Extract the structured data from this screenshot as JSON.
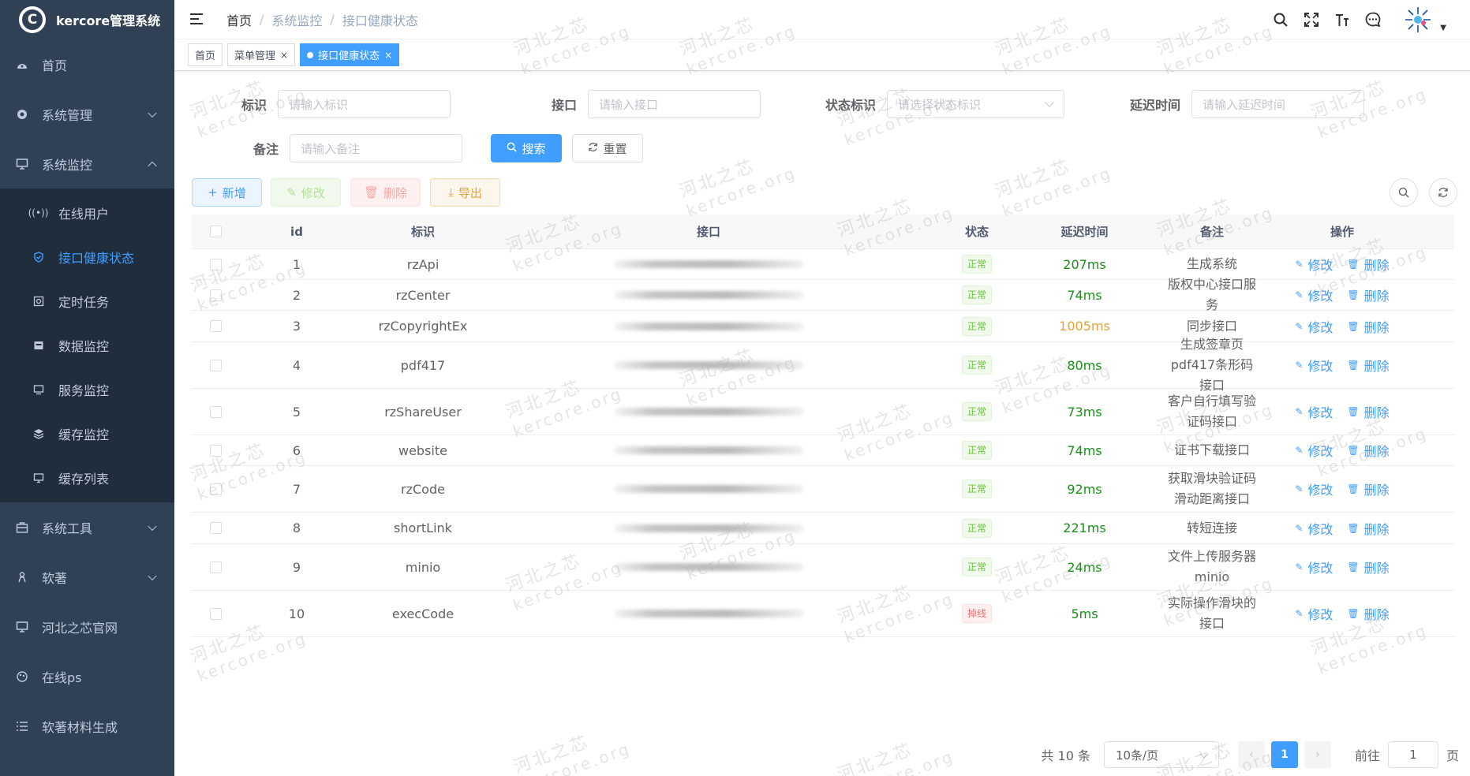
{
  "app": {
    "title": "kercore管理系统",
    "logo_letter": "C"
  },
  "sidebar": {
    "items": [
      {
        "label": "首页",
        "icon": "dashboard-icon"
      },
      {
        "label": "系统管理",
        "icon": "gear-icon"
      },
      {
        "label": "系统监控",
        "icon": "monitor-icon"
      },
      {
        "label": "系统工具",
        "icon": "toolbox-icon"
      },
      {
        "label": "软著",
        "icon": "user-icon"
      },
      {
        "label": "河北之芯官网",
        "icon": "monitor-icon"
      },
      {
        "label": "在线ps",
        "icon": "palette-icon"
      },
      {
        "label": "软著材料生成",
        "icon": "list-icon"
      }
    ],
    "sub_items": [
      {
        "label": "在线用户",
        "icon": "online-icon"
      },
      {
        "label": "接口健康状态",
        "icon": "shield-icon"
      },
      {
        "label": "定时任务",
        "icon": "job-icon"
      },
      {
        "label": "数据监控",
        "icon": "database-icon"
      },
      {
        "label": "服务监控",
        "icon": "server-icon"
      },
      {
        "label": "缓存监控",
        "icon": "redis-icon"
      },
      {
        "label": "缓存列表",
        "icon": "list-icon"
      }
    ]
  },
  "breadcrumb": {
    "home": "首页",
    "section": "系统监控",
    "current": "接口健康状态",
    "sep": "/"
  },
  "tabs": [
    {
      "label": "首页"
    },
    {
      "label": "菜单管理",
      "close": "×"
    },
    {
      "label": "接口健康状态",
      "close": "×"
    }
  ],
  "form": {
    "label_id": "标识",
    "ph_id": "请输入标识",
    "label_api": "接口",
    "ph_api": "请输入接口",
    "label_status": "状态标识",
    "ph_status": "请选择状态标识",
    "label_delay": "延迟时间",
    "ph_delay": "请输入延迟时间",
    "label_remark": "备注",
    "ph_remark": "请输入备注",
    "search": "搜索",
    "reset": "重置"
  },
  "toolbar": {
    "add": "新增",
    "edit": "修改",
    "delete": "删除",
    "export": "导出"
  },
  "table": {
    "headers": [
      "id",
      "标识",
      "接口",
      "状态",
      "延迟时间",
      "备注",
      "操作"
    ],
    "edit_label": "修改",
    "delete_label": "删除",
    "rows": [
      {
        "id": "1",
        "name": "rzApi",
        "status": "正常",
        "status_type": "ok",
        "delay": "207ms",
        "delay_type": "ok",
        "remark": "生成系统",
        "h": 39
      },
      {
        "id": "2",
        "name": "rzCenter",
        "status": "正常",
        "status_type": "ok",
        "delay": "74ms",
        "delay_type": "ok",
        "remark": "版权中心接口服务",
        "h": 39
      },
      {
        "id": "3",
        "name": "rzCopyrightEx",
        "status": "正常",
        "status_type": "ok",
        "delay": "1005ms",
        "delay_type": "warn",
        "remark": "同步接口",
        "h": 40
      },
      {
        "id": "4",
        "name": "pdf417",
        "status": "正常",
        "status_type": "ok",
        "delay": "80ms",
        "delay_type": "ok",
        "remark": "生成签章页pdf417条形码接口",
        "h": 59
      },
      {
        "id": "5",
        "name": "rzShareUser",
        "status": "正常",
        "status_type": "ok",
        "delay": "73ms",
        "delay_type": "ok",
        "remark": "客户自行填写验证码接口",
        "h": 59
      },
      {
        "id": "6",
        "name": "website",
        "status": "正常",
        "status_type": "ok",
        "delay": "74ms",
        "delay_type": "ok",
        "remark": "证书下载接口",
        "h": 39
      },
      {
        "id": "7",
        "name": "rzCode",
        "status": "正常",
        "status_type": "ok",
        "delay": "92ms",
        "delay_type": "ok",
        "remark": "获取滑块验证码滑动距离接口",
        "h": 59
      },
      {
        "id": "8",
        "name": "shortLink",
        "status": "正常",
        "status_type": "ok",
        "delay": "221ms",
        "delay_type": "ok",
        "remark": "转短连接",
        "h": 40
      },
      {
        "id": "9",
        "name": "minio",
        "status": "正常",
        "status_type": "ok",
        "delay": "24ms",
        "delay_type": "ok",
        "remark": "文件上传服务器minio",
        "h": 59
      },
      {
        "id": "10",
        "name": "execCode",
        "status": "掉线",
        "status_type": "bad",
        "delay": "5ms",
        "delay_type": "ok",
        "remark": "实际操作滑块的接口",
        "h": 59
      }
    ]
  },
  "pagination": {
    "total": "共 10 条",
    "page_size": "10条/页",
    "current": "1",
    "goto": "前往",
    "goto_value": "1",
    "page_suffix": "页"
  },
  "watermark": {
    "line1": "河北之芯",
    "line2": "kercore.org"
  },
  "colors": {
    "primary": "#409eff",
    "sidebar": "#304156",
    "sidebar_sub": "#1f2d3d",
    "success": "#67c23a",
    "danger": "#f56c6c",
    "warning": "#e6a23c"
  }
}
